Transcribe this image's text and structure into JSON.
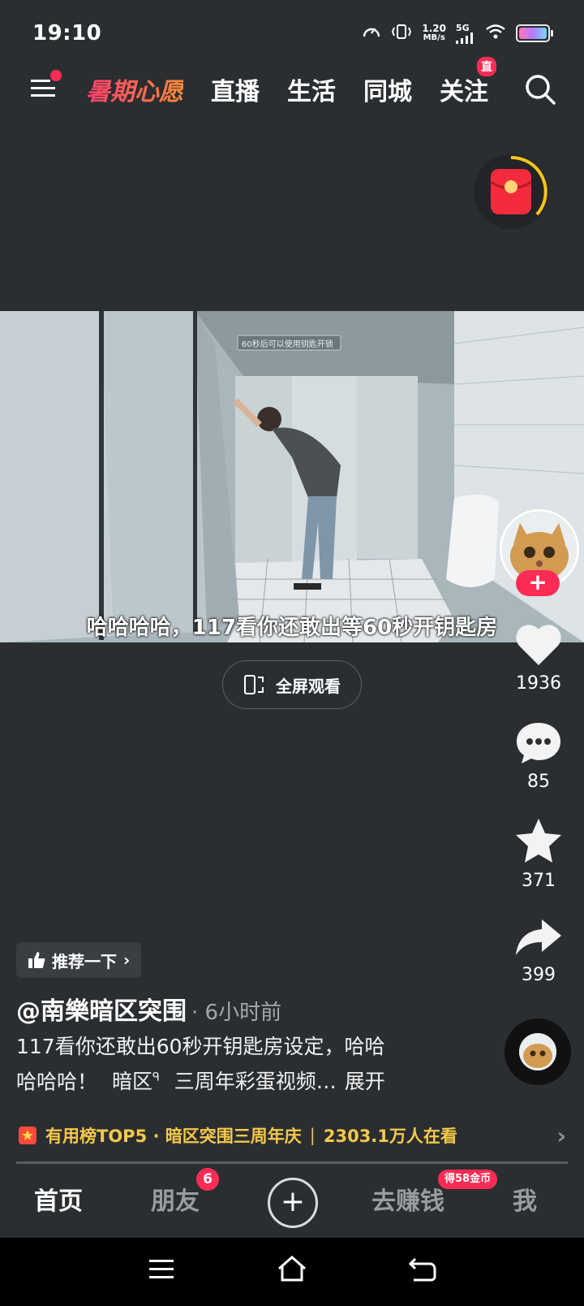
{
  "status": {
    "time": "19:10",
    "net_speed_value": "1.20",
    "net_speed_unit": "MB/s",
    "network": "5G",
    "icons": [
      "speedometer-icon",
      "vibrate-icon",
      "signal-icon",
      "wifi-icon",
      "battery-icon"
    ]
  },
  "top_nav": {
    "menu_icon": "menu-icon",
    "tabs": [
      {
        "label": "暑期心愿"
      },
      {
        "label": "直播"
      },
      {
        "label": "生活"
      },
      {
        "label": "同城"
      },
      {
        "label": "关注"
      }
    ],
    "live_badge": "直",
    "search_icon": "search-icon"
  },
  "video": {
    "subtitle": "哈哈哈哈，117看你还敢出等60秒开钥匙房",
    "in_video_text": "60秒后可以使用钥匙开锁"
  },
  "fullscreen_button": {
    "label": "全屏观看",
    "icon": "fullscreen-icon"
  },
  "rail": {
    "like": {
      "icon": "heart-icon",
      "count": "1936"
    },
    "comment": {
      "icon": "comment-icon",
      "count": "85"
    },
    "favorite": {
      "icon": "star-icon",
      "count": "371"
    },
    "share": {
      "icon": "share-icon",
      "count": "399"
    },
    "follow": "+"
  },
  "post": {
    "recommend_label": "推荐一下",
    "author": "@南樂暗区突围",
    "time_ago": "· 6小时前",
    "desc_line1": "117看你还敢出60秒开钥匙房设定，哈哈",
    "desc_line2_text": "哈哈哈！",
    "desc_tag": "暗区",
    "desc_tail": "三周年彩蛋视频…",
    "expand": "展开"
  },
  "hot_bar": {
    "part1": "有用榜TOP5 · 暗区突围三周年庆",
    "part2": "2303.1万人在看",
    "separator": "|"
  },
  "tabbar": {
    "home": "首页",
    "friends": "朋友",
    "friends_badge": "6",
    "plus": "+",
    "earn": "去赚钱",
    "earn_badge": "得58金币",
    "me": "我"
  },
  "colors": {
    "background": "#2b2e31",
    "accent": "#fe2c55",
    "hot_text": "#f6c94a"
  }
}
